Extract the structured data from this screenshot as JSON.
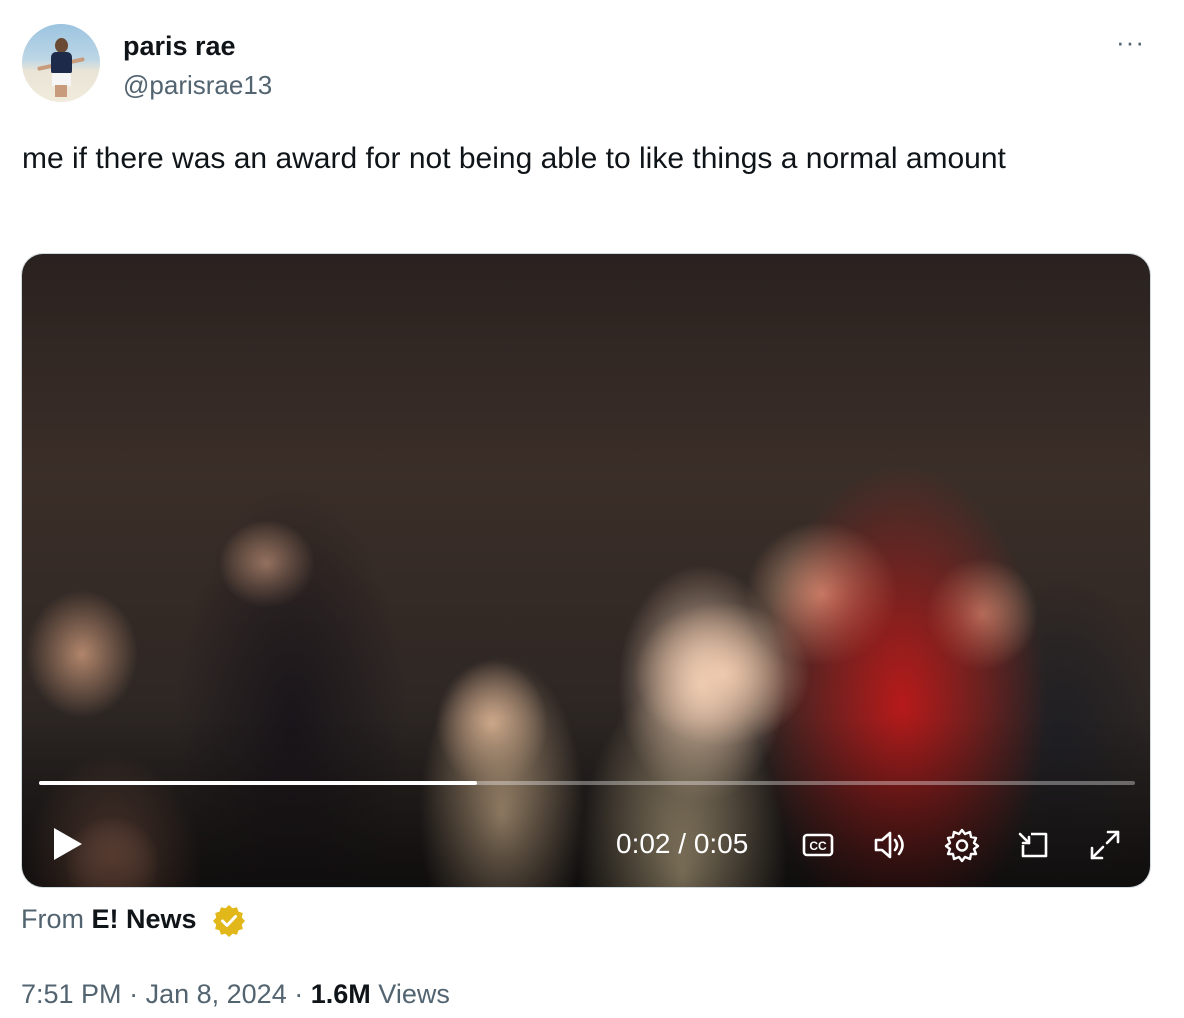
{
  "author": {
    "display_name": "paris rae",
    "handle": "@parisrae13"
  },
  "more_menu": "···",
  "tweet": {
    "text": "me if there was an award for not being able to like things a normal amount"
  },
  "video": {
    "progress_fraction": 0.4,
    "time_display": "0:02 / 0:05",
    "controls": [
      "play-icon",
      "closed-captions-icon",
      "volume-icon",
      "settings-icon",
      "picture-in-picture-icon",
      "fullscreen-icon"
    ]
  },
  "attribution": {
    "prefix": "From",
    "source": "E! News",
    "verified_color": "#e2b719"
  },
  "meta": {
    "time": "7:51 PM",
    "separator": "·",
    "date": "Jan 8, 2024",
    "views_count": "1.6M",
    "views_label": "Views"
  }
}
